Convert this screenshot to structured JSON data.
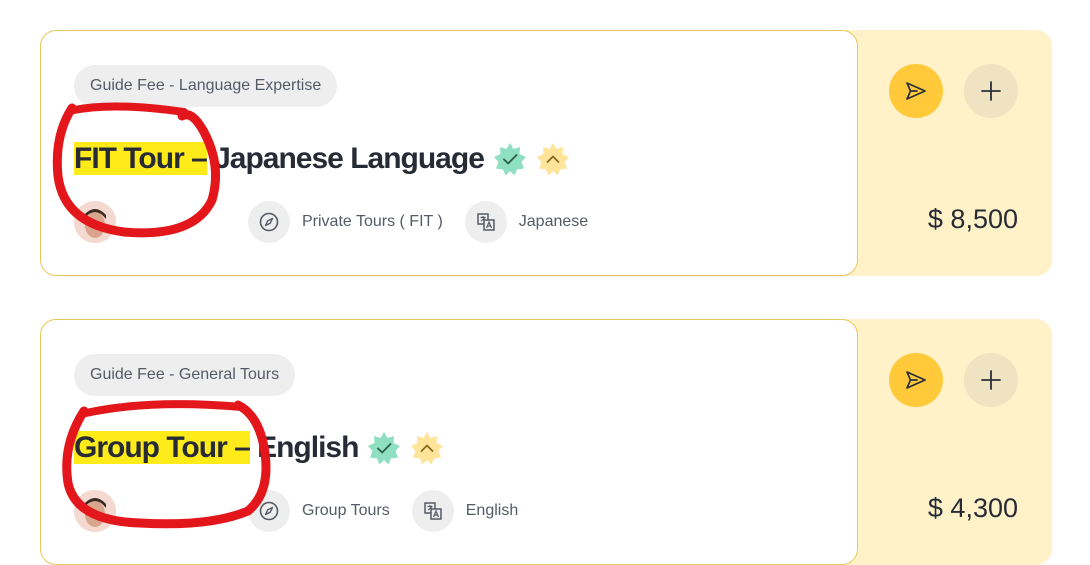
{
  "colors": {
    "accent_yellow": "#ffc93a",
    "panel_bg": "#fff1c8",
    "card_border": "#e6c85a",
    "highlight": "#ffeb1a",
    "annotation_red": "#e3161b",
    "verified_green": "#8fe0c2",
    "badge_yellow": "#ffe49a"
  },
  "cards": [
    {
      "category": "Guide Fee - Language Expertise",
      "title_highlight": "FIT Tour –",
      "title_rest": " Japanese Language",
      "badges": [
        "verified-check-icon",
        "chevron-up-badge-icon"
      ],
      "meta": [
        {
          "icon": "compass-icon",
          "label": "Private Tours ( FIT )"
        },
        {
          "icon": "translate-icon",
          "label": "Japanese"
        }
      ],
      "price": "$ 8,500"
    },
    {
      "category": "Guide Fee - General Tours",
      "title_highlight": "Group Tour –",
      "title_rest": " English",
      "badges": [
        "verified-check-icon",
        "chevron-up-badge-icon"
      ],
      "meta": [
        {
          "icon": "compass-icon",
          "label": "Group Tours"
        },
        {
          "icon": "translate-icon",
          "label": "English"
        }
      ],
      "price": "$ 4,300"
    }
  ]
}
